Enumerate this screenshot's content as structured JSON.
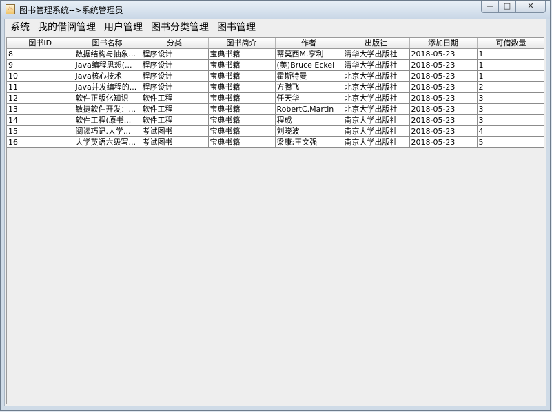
{
  "window": {
    "title": "图书管理系统-->系统管理员",
    "buttons": {
      "minimize": "—",
      "maximize": "□",
      "close": "✕"
    }
  },
  "menu": [
    "系统",
    "我的借阅管理",
    "用户管理",
    "图书分类管理",
    "图书管理"
  ],
  "table": {
    "headers": [
      "图书ID",
      "图书名称",
      "分类",
      "图书简介",
      "作者",
      "出版社",
      "添加日期",
      "可借数量"
    ],
    "rows": [
      [
        "8",
        "数据结构与抽象...",
        "程序设计",
        "宝典书籍",
        "蒂莫西M.亨利",
        "清华大学出版社",
        "2018-05-23",
        "1"
      ],
      [
        "9",
        "Java编程思想(...",
        "程序设计",
        "宝典书籍",
        "(美)Bruce Eckel",
        "清华大学出版社",
        "2018-05-23",
        "1"
      ],
      [
        "10",
        "Java核心技术",
        "程序设计",
        "宝典书籍",
        "霍斯特曼",
        "北京大学出版社",
        "2018-05-23",
        "1"
      ],
      [
        "11",
        "Java并发编程的...",
        "程序设计",
        "宝典书籍",
        "方腾飞",
        "北京大学出版社",
        "2018-05-23",
        "2"
      ],
      [
        "12",
        "软件正版化知识",
        "软件工程",
        "宝典书籍",
        "任天华",
        "北京大学出版社",
        "2018-05-23",
        "3"
      ],
      [
        "13",
        "敏捷软件开发：...",
        "软件工程",
        "宝典书籍",
        "RobertC.Martin",
        "北京大学出版社",
        "2018-05-23",
        "3"
      ],
      [
        "14",
        "软件工程(原书...",
        "软件工程",
        "宝典书籍",
        "程成",
        "南京大学出版社",
        "2018-05-23",
        "3"
      ],
      [
        "15",
        "阅读巧记.大学...",
        "考试图书",
        "宝典书籍",
        "刘晓波",
        "南京大学出版社",
        "2018-05-23",
        "4"
      ],
      [
        "16",
        "大学英语六级写...",
        "考试图书",
        "宝典书籍",
        "梁康;王文强",
        "南京大学出版社",
        "2018-05-23",
        "5"
      ]
    ]
  }
}
